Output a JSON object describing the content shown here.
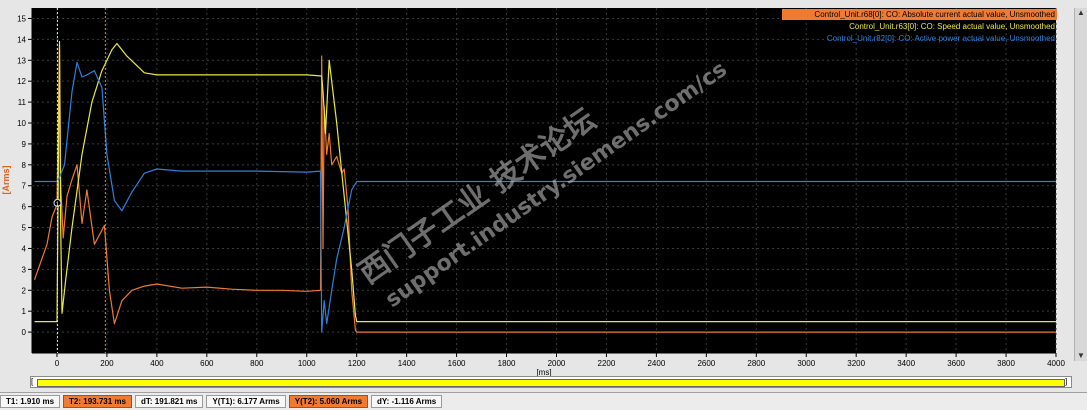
{
  "chart_data": {
    "type": "line",
    "xlabel": "[ms]",
    "ylabel": "[Arms]",
    "xlim": [
      -100,
      4000
    ],
    "ylim": [
      -1,
      15.5
    ],
    "xticks": [
      0,
      200,
      400,
      600,
      800,
      1000,
      1200,
      1400,
      1600,
      1800,
      2000,
      2200,
      2400,
      2600,
      2800,
      3000,
      3200,
      3400,
      3600,
      3800,
      4000
    ],
    "yticks": [
      0,
      1,
      2,
      3,
      4,
      5,
      6,
      7,
      8,
      9,
      10,
      11,
      12,
      13,
      14,
      15
    ],
    "grid": true,
    "legend_position": "top-right",
    "series": [
      {
        "name": "Control_Unit.r68[0]: CO: Absolute current actual value, Unsmoothed",
        "color": "#f07a30",
        "x": [
          -90,
          -40,
          -20,
          0,
          10,
          15,
          25,
          40,
          60,
          80,
          100,
          120,
          150,
          190,
          210,
          230,
          260,
          300,
          350,
          400,
          500,
          600,
          700,
          800,
          900,
          1000,
          1055,
          1060,
          1065,
          1070,
          1080,
          1090,
          1100,
          1120,
          1140,
          1150,
          1165,
          1180,
          1195,
          1200,
          1400,
          4000
        ],
        "values": [
          2.5,
          4.2,
          5.5,
          6.1,
          13.7,
          7.0,
          4.5,
          6.5,
          7.3,
          8.0,
          5.2,
          6.8,
          4.2,
          5.1,
          2.0,
          0.4,
          1.5,
          2.0,
          2.2,
          2.3,
          2.1,
          2.15,
          2.05,
          2.0,
          2.0,
          1.95,
          2.0,
          13.2,
          4.0,
          10.8,
          8.5,
          9.5,
          8.0,
          8.4,
          7.6,
          7.8,
          6.0,
          2.0,
          0.1,
          0.0,
          0.0,
          0.0
        ]
      },
      {
        "name": "Control_Unit.r63[0]: CO: Speed actual value, Unsmoothed",
        "color": "#e8e840",
        "x": [
          -90,
          0,
          10,
          15,
          20,
          35,
          60,
          100,
          140,
          180,
          200,
          220,
          240,
          280,
          350,
          400,
          600,
          800,
          1000,
          1060,
          1065,
          1075,
          1090,
          1120,
          1150,
          1180,
          1195,
          1200,
          4000
        ],
        "values": [
          0.5,
          0.5,
          13.9,
          5.0,
          0.9,
          2.5,
          5.0,
          8.5,
          11.0,
          12.5,
          13.0,
          13.5,
          13.8,
          13.2,
          12.4,
          12.3,
          12.3,
          12.3,
          12.3,
          12.25,
          11.5,
          9.5,
          13.0,
          10.0,
          6.5,
          3.0,
          0.8,
          0.5,
          0.5
        ]
      },
      {
        "name": "Control_Unit.r82[0]: CO: Active power actual value, Unsmoothed",
        "color": "#2e80d8",
        "x": [
          -90,
          0,
          10,
          30,
          60,
          80,
          100,
          120,
          150,
          180,
          200,
          230,
          260,
          300,
          350,
          400,
          500,
          600,
          700,
          800,
          1000,
          1055,
          1060,
          1070,
          1080,
          1090,
          1100,
          1120,
          1150,
          1180,
          1200,
          1300,
          4000
        ],
        "values": [
          7.2,
          7.2,
          7.4,
          8.0,
          11.5,
          12.9,
          12.2,
          12.3,
          12.5,
          11.7,
          8.5,
          6.3,
          5.8,
          6.7,
          7.6,
          7.8,
          7.7,
          7.7,
          7.7,
          7.7,
          7.65,
          7.7,
          0.0,
          1.5,
          0.4,
          1.2,
          2.0,
          3.5,
          5.0,
          6.8,
          7.2,
          7.2,
          7.2
        ]
      }
    ],
    "cursors": [
      {
        "name": "T1",
        "x": 1.91,
        "color": "#e8e8a0"
      },
      {
        "name": "T2",
        "x": 193.731,
        "color": "#f07a30"
      }
    ],
    "cursor_markers": [
      {
        "label": "1",
        "x": 1.91,
        "y": 6.177
      }
    ]
  },
  "watermark": {
    "line1": "西门子工业 技术论坛",
    "line2": "support.industry.siemens.com/cs"
  },
  "status": {
    "t1": "T1: 1.910 ms",
    "t2": "T2: 193.731 ms",
    "dt": "dT: 191.821 ms",
    "yt1": "Y(T1): 6.177 Arms",
    "yt2": "Y(T2): 5.060 Arms",
    "dy": "dY: -1.116 Arms"
  },
  "colors": {
    "plot_bg": "#000000",
    "grid": "#3a3a3a",
    "axis_text": "#000000",
    "ylabel_color": "#e06020"
  }
}
